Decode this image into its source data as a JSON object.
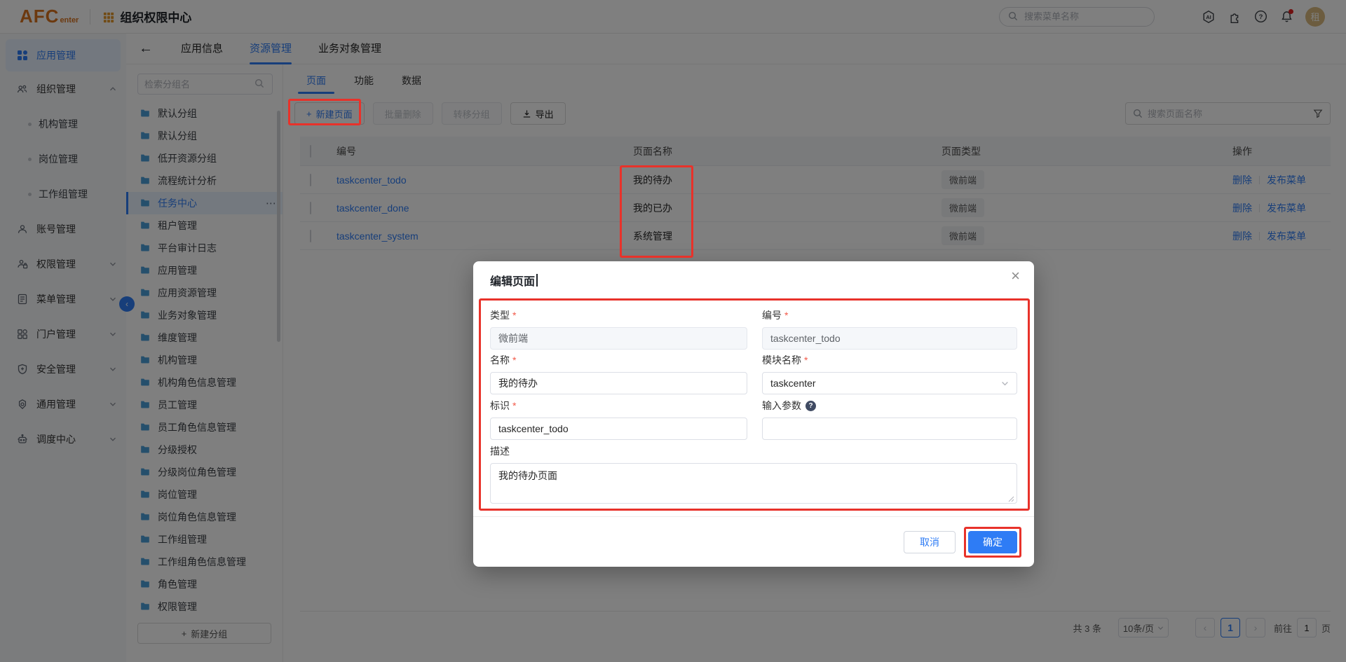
{
  "colors": {
    "accent": "#2e7cf5",
    "annotation_red": "#e8322a",
    "logo_orange": "#d9731f",
    "grid_icon_orange": "#e2992f",
    "folder_blue": "#4a9fd8",
    "avatar_gold": "#d8b97f",
    "notification_dot": "#e02020"
  },
  "header": {
    "logo_main": "AFC",
    "logo_sub": "enter",
    "app_title": "组织权限中心",
    "search_placeholder": "搜索菜单名称",
    "avatar_text": "租"
  },
  "icons": {
    "back": "←",
    "plus": "+",
    "more": "⋯",
    "close": "×"
  },
  "sidebar": {
    "items": [
      {
        "label": "应用管理"
      },
      {
        "label": "组织管理",
        "children": [
          "机构管理",
          "岗位管理",
          "工作组管理"
        ]
      },
      {
        "label": "账号管理"
      },
      {
        "label": "权限管理"
      },
      {
        "label": "菜单管理"
      },
      {
        "label": "门户管理"
      },
      {
        "label": "安全管理"
      },
      {
        "label": "通用管理"
      },
      {
        "label": "调度中心"
      }
    ]
  },
  "content_header": {
    "tabs": [
      {
        "label": "应用信息"
      },
      {
        "label": "资源管理"
      },
      {
        "label": "业务对象管理"
      }
    ]
  },
  "groups": {
    "search_placeholder": "检索分组名",
    "selected": "任务中心",
    "new_group_label": "新建分组",
    "items": [
      "默认分组",
      "默认分组",
      "低开资源分组",
      "流程统计分析",
      "任务中心",
      "租户管理",
      "平台审计日志",
      "应用管理",
      "应用资源管理",
      "业务对象管理",
      "维度管理",
      "机构管理",
      "机构角色信息管理",
      "员工管理",
      "员工角色信息管理",
      "分级授权",
      "分级岗位角色管理",
      "岗位管理",
      "岗位角色信息管理",
      "工作组管理",
      "工作组角色信息管理",
      "角色管理",
      "权限管理"
    ]
  },
  "main": {
    "tabs": [
      {
        "label": "页面"
      },
      {
        "label": "功能"
      },
      {
        "label": "数据"
      }
    ],
    "toolbar": {
      "new_page": "新建页面",
      "batch_delete": "批量删除",
      "move_group": "转移分组",
      "export": "导出"
    },
    "search_placeholder": "搜索页面名称",
    "table": {
      "columns": [
        "编号",
        "页面名称",
        "页面类型",
        "操作"
      ],
      "rows": [
        {
          "code": "taskcenter_todo",
          "name": "我的待办",
          "type": "微前端"
        },
        {
          "code": "taskcenter_done",
          "name": "我的已办",
          "type": "微前端"
        },
        {
          "code": "taskcenter_system",
          "name": "系统管理",
          "type": "微前端"
        }
      ],
      "row_actions": [
        "删除",
        "发布菜单"
      ]
    },
    "pagination": {
      "total": "共 3 条",
      "page_size": "10条/页",
      "prev": "‹",
      "current_page": "1",
      "next": "›",
      "goto_label": "前往",
      "goto_value": "1",
      "goto_suffix": "页"
    }
  },
  "modal": {
    "title": "编辑页面",
    "close": "×",
    "required_mark": "*",
    "fields": {
      "type": {
        "label": "类型",
        "value": "微前端"
      },
      "code": {
        "label": "编号",
        "value": "taskcenter_todo"
      },
      "name": {
        "label": "名称",
        "value": "我的待办"
      },
      "module": {
        "label": "模块名称",
        "value": "taskcenter"
      },
      "ident": {
        "label": "标识",
        "value": "taskcenter_todo"
      },
      "params": {
        "label": "输入参数",
        "value": ""
      },
      "desc": {
        "label": "描述",
        "value": "我的待办页面"
      }
    },
    "help_glyph": "?",
    "cancel": "取消",
    "ok": "确定"
  }
}
